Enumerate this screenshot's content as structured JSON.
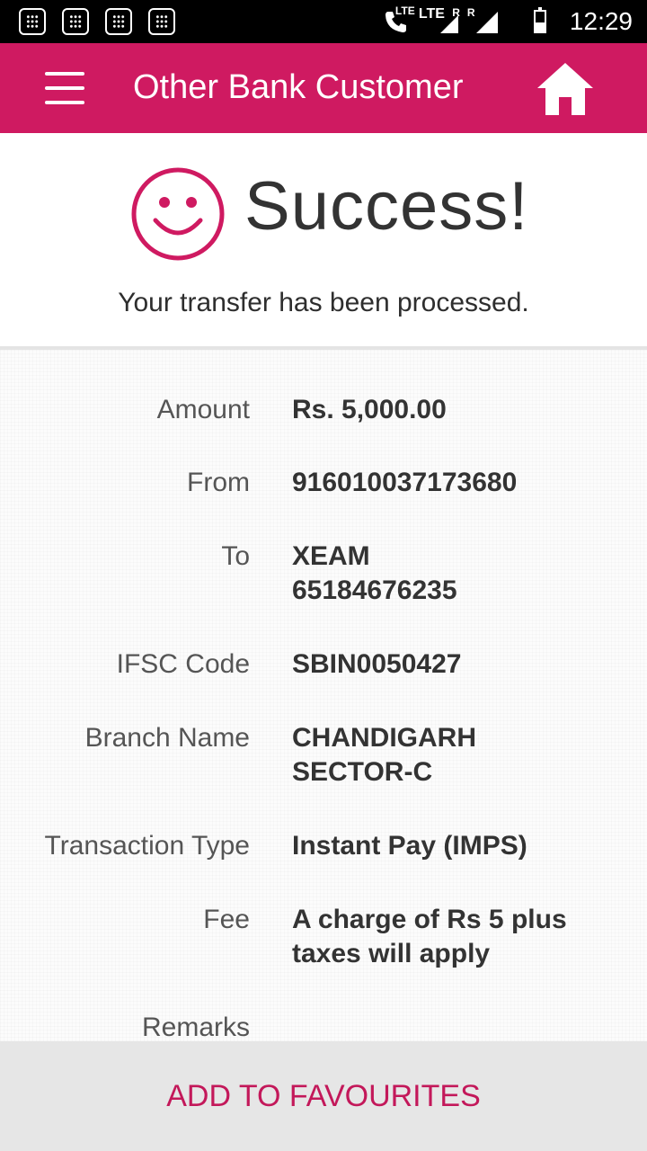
{
  "status_bar": {
    "lte_left": "LTE",
    "lte_main": "LTE",
    "roaming_1": "R",
    "roaming_2": "R",
    "time": "12:29"
  },
  "app_bar": {
    "title": "Other Bank Customer"
  },
  "success": {
    "title": "Success!",
    "message": "Your transfer has been processed."
  },
  "details": [
    {
      "label": "Amount",
      "value": "Rs. 5,000.00"
    },
    {
      "label": "From",
      "value": "916010037173680"
    },
    {
      "label": "To",
      "value": "XEAM\n65184676235"
    },
    {
      "label": "IFSC Code",
      "value": "SBIN0050427"
    },
    {
      "label": "Branch Name",
      "value": "CHANDIGARH\nSECTOR-C"
    },
    {
      "label": "Transaction Type",
      "value": "Instant Pay (IMPS)"
    },
    {
      "label": "Fee",
      "value": "A charge of Rs 5 plus taxes will apply"
    },
    {
      "label": "Remarks",
      "value": ""
    }
  ],
  "actions": {
    "add_to_favourites": "ADD TO FAVOURITES"
  },
  "colors": {
    "brand": "#cf1a61",
    "button_text": "#c3185a",
    "button_bg": "#e6e6e6"
  },
  "icons": [
    "app-notification-icon",
    "call-lte-icon",
    "signal-icon",
    "battery-icon",
    "menu-icon",
    "home-icon",
    "smiley-icon"
  ]
}
